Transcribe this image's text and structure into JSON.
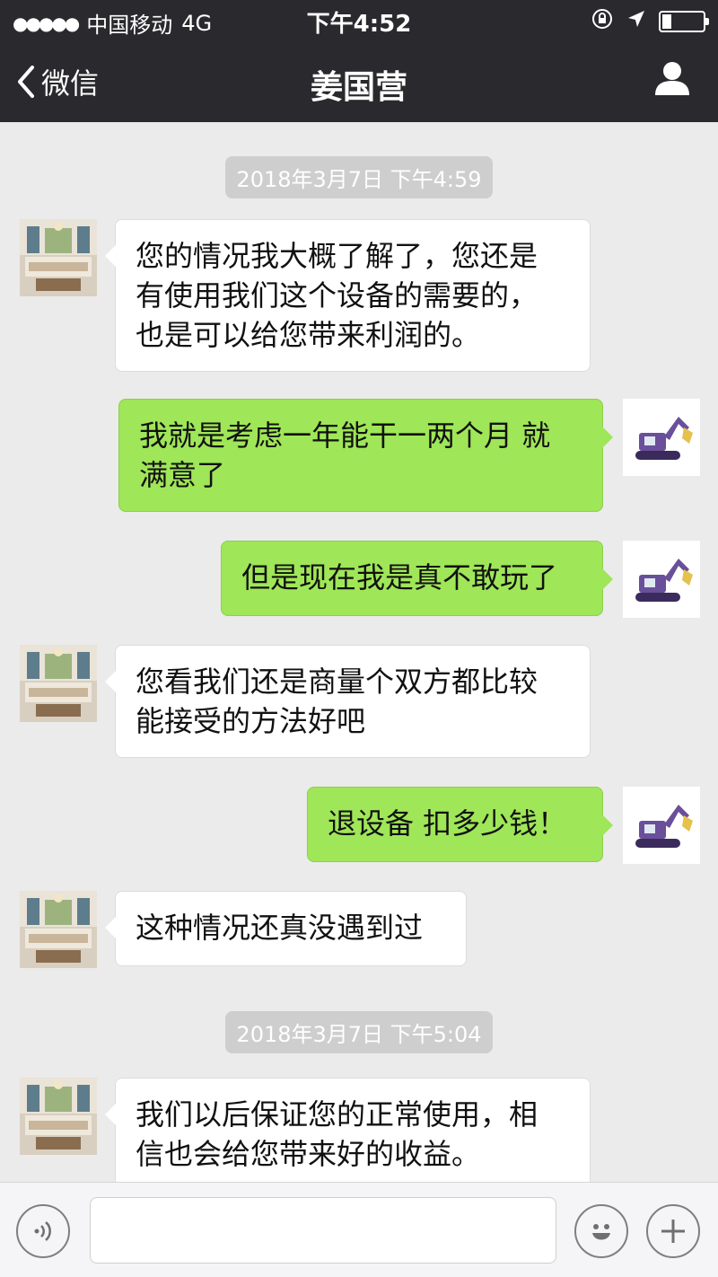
{
  "status_bar": {
    "carrier": "中国移动",
    "network": "4G",
    "time": "下午4:52",
    "signal_dots": "●●●●●"
  },
  "nav": {
    "back_label": "微信",
    "title": "姜国营"
  },
  "messages": [
    {
      "type": "timestamp",
      "text": "2018年3月7日 下午4:59"
    },
    {
      "type": "received",
      "lines": [
        "您的情况我大概了解了，您还是",
        "有使用我们这个设备的需要的，",
        "也是可以给您带来利润的。"
      ],
      "avatar": "living-room-avatar"
    },
    {
      "type": "sent",
      "lines": [
        "我就是考虑一年能干一两个月 就",
        "满意了"
      ],
      "avatar": "excavator-avatar"
    },
    {
      "type": "sent",
      "lines": [
        "但是现在我是真不敢玩了"
      ],
      "avatar": "excavator-avatar"
    },
    {
      "type": "received",
      "lines": [
        "您看我们还是商量个双方都比较",
        "能接受的方法好吧"
      ],
      "avatar": "living-room-avatar"
    },
    {
      "type": "sent",
      "lines": [
        "退设备 扣多少钱！"
      ],
      "avatar": "excavator-avatar"
    },
    {
      "type": "received",
      "lines": [
        "这种情况还真没遇到过"
      ],
      "avatar": "living-room-avatar"
    },
    {
      "type": "timestamp",
      "text": "2018年3月7日 下午5:04"
    },
    {
      "type": "received",
      "lines": [
        "我们以后保证您的正常使用，相",
        "信也会给您带来好的收益。"
      ],
      "avatar": "living-room-avatar"
    }
  ],
  "input_bar": {
    "voice_icon": "voice-icon",
    "emoji_icon": "emoji-icon",
    "plus_icon": "plus-icon"
  },
  "colors": {
    "nav_bg": "#2a2a2e",
    "chat_bg": "#ebebeb",
    "sent_bubble": "#9fe658",
    "received_bubble": "#ffffff"
  }
}
